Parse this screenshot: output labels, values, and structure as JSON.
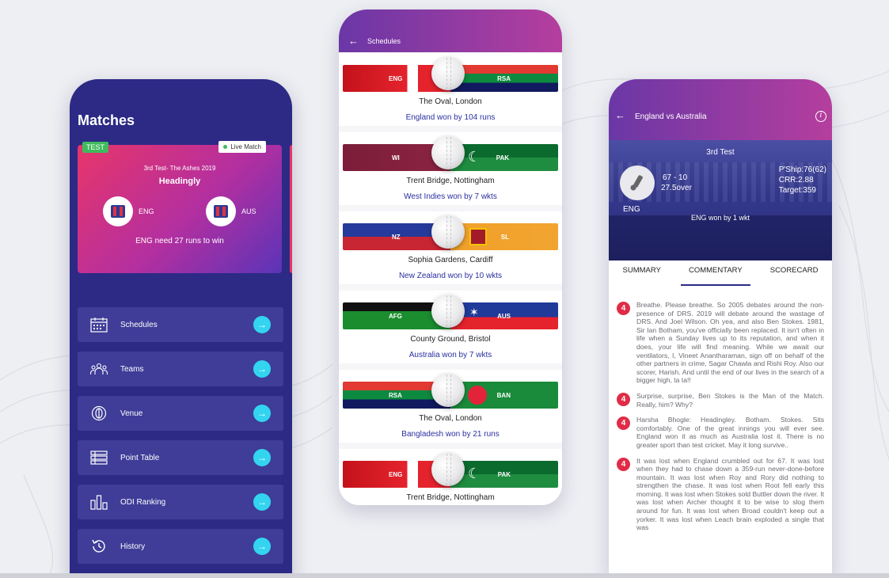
{
  "colors": {
    "matches_bg": "#2c2a85",
    "menu_item_bg": "#3f3d98",
    "arrow_accent": "#33d4ef",
    "header_gradient_start": "#6a37a6",
    "header_gradient_end": "#b53e9e",
    "result_text": "#2a2fa0",
    "ball_badge": "#e02c47"
  },
  "matches": {
    "title": "Matches",
    "card": {
      "badge": "TEST",
      "live_label": "Live Match",
      "series": "3rd Test- The Ashes 2019",
      "venue": "Headingly",
      "team1": "ENG",
      "team2": "AUS",
      "status": "ENG need 27 runs to win"
    },
    "menu": [
      {
        "label": "Schedules",
        "icon": "calendar-icon"
      },
      {
        "label": "Teams",
        "icon": "teams-icon"
      },
      {
        "label": "Venue",
        "icon": "venue-icon"
      },
      {
        "label": "Point Table",
        "icon": "point-table-icon"
      },
      {
        "label": "ODI Ranking",
        "icon": "ranking-icon"
      },
      {
        "label": "History",
        "icon": "history-icon"
      }
    ]
  },
  "schedules": {
    "title": "Schedules",
    "items": [
      {
        "team1": "ENG",
        "team2": "RSA",
        "venue": "The Oval, London",
        "result": "England won by 104 runs"
      },
      {
        "team1": "WI",
        "team2": "PAK",
        "venue": "Trent Bridge, Nottingham",
        "result": "West Indies won by 7 wkts"
      },
      {
        "team1": "NZ",
        "team2": "SL",
        "venue": "Sophia Gardens, Cardiff",
        "result": "New Zealand won by 10 wkts"
      },
      {
        "team1": "AFG",
        "team2": "AUS",
        "venue": "County Ground, Bristol",
        "result": "Australia won by 7 wkts"
      },
      {
        "team1": "RSA",
        "team2": "BAN",
        "venue": "The Oval, London",
        "result": "Bangladesh won by 21 runs"
      },
      {
        "team1": "ENG",
        "team2": "PAK",
        "venue": "Trent Bridge, Nottingham",
        "result": ""
      }
    ]
  },
  "commentary": {
    "title": "England vs Australia",
    "match_no": "3rd Test",
    "score": "67 - 10",
    "overs": "27.5over",
    "team": "ENG",
    "partnership": "P'Ship:76(62)",
    "crr": "CRR:2.88",
    "target": "Target:359",
    "result": "ENG won by 1 wkt",
    "tabs": [
      "SUMMARY",
      "COMMENTARY",
      "SCORECARD"
    ],
    "entries": [
      {
        "ball": "4",
        "text": "Breathe. Please breathe. So 2005 debates around the non-presence of DRS. 2019 will debate around the wastage of DRS. And Joel Wilson. Oh yea, and also Ben Stokes. 1981, Sir Ian Botham, you've officially been replaced. It isn't often in life when a Sunday lives up to its reputation, and when it does, your life will find meaning. While we await our ventilators, I, Vineet Anantharaman, sign off on behalf of the other partners in crime, Sagar Chawla and Rishi Roy. Also our scorer, Harish. And until the end of our lives in the search of a bigger high, ta ta!!"
      },
      {
        "ball": "4",
        "text": "Surprise, surprise, Ben Stokes is the Man of the Match. Really, him? Why?"
      },
      {
        "ball": "4",
        "text": "Harsha Bhogle: Headingley. Botham. Stokes. Sits comfortably. One of the great innings you will ever see. England won it as much as Australia lost it. There is no greater sport than test cricket. May it long survive.."
      },
      {
        "ball": "4",
        "text": "It was lost when England crumbled out for 67. It was lost when they had to chase down a 359-run never-done-before mountain. It was lost when Roy and Rory did nothing to strengthen the chase. It was lost when Root fell early this morning. It was lost when Stokes sold Buttler down the river. It was lost when Archer thought it to be wise to slog them around for fun. It was lost when Broad couldn't keep out a yorker. It was lost when Leach brain exploded a single that was"
      }
    ]
  }
}
